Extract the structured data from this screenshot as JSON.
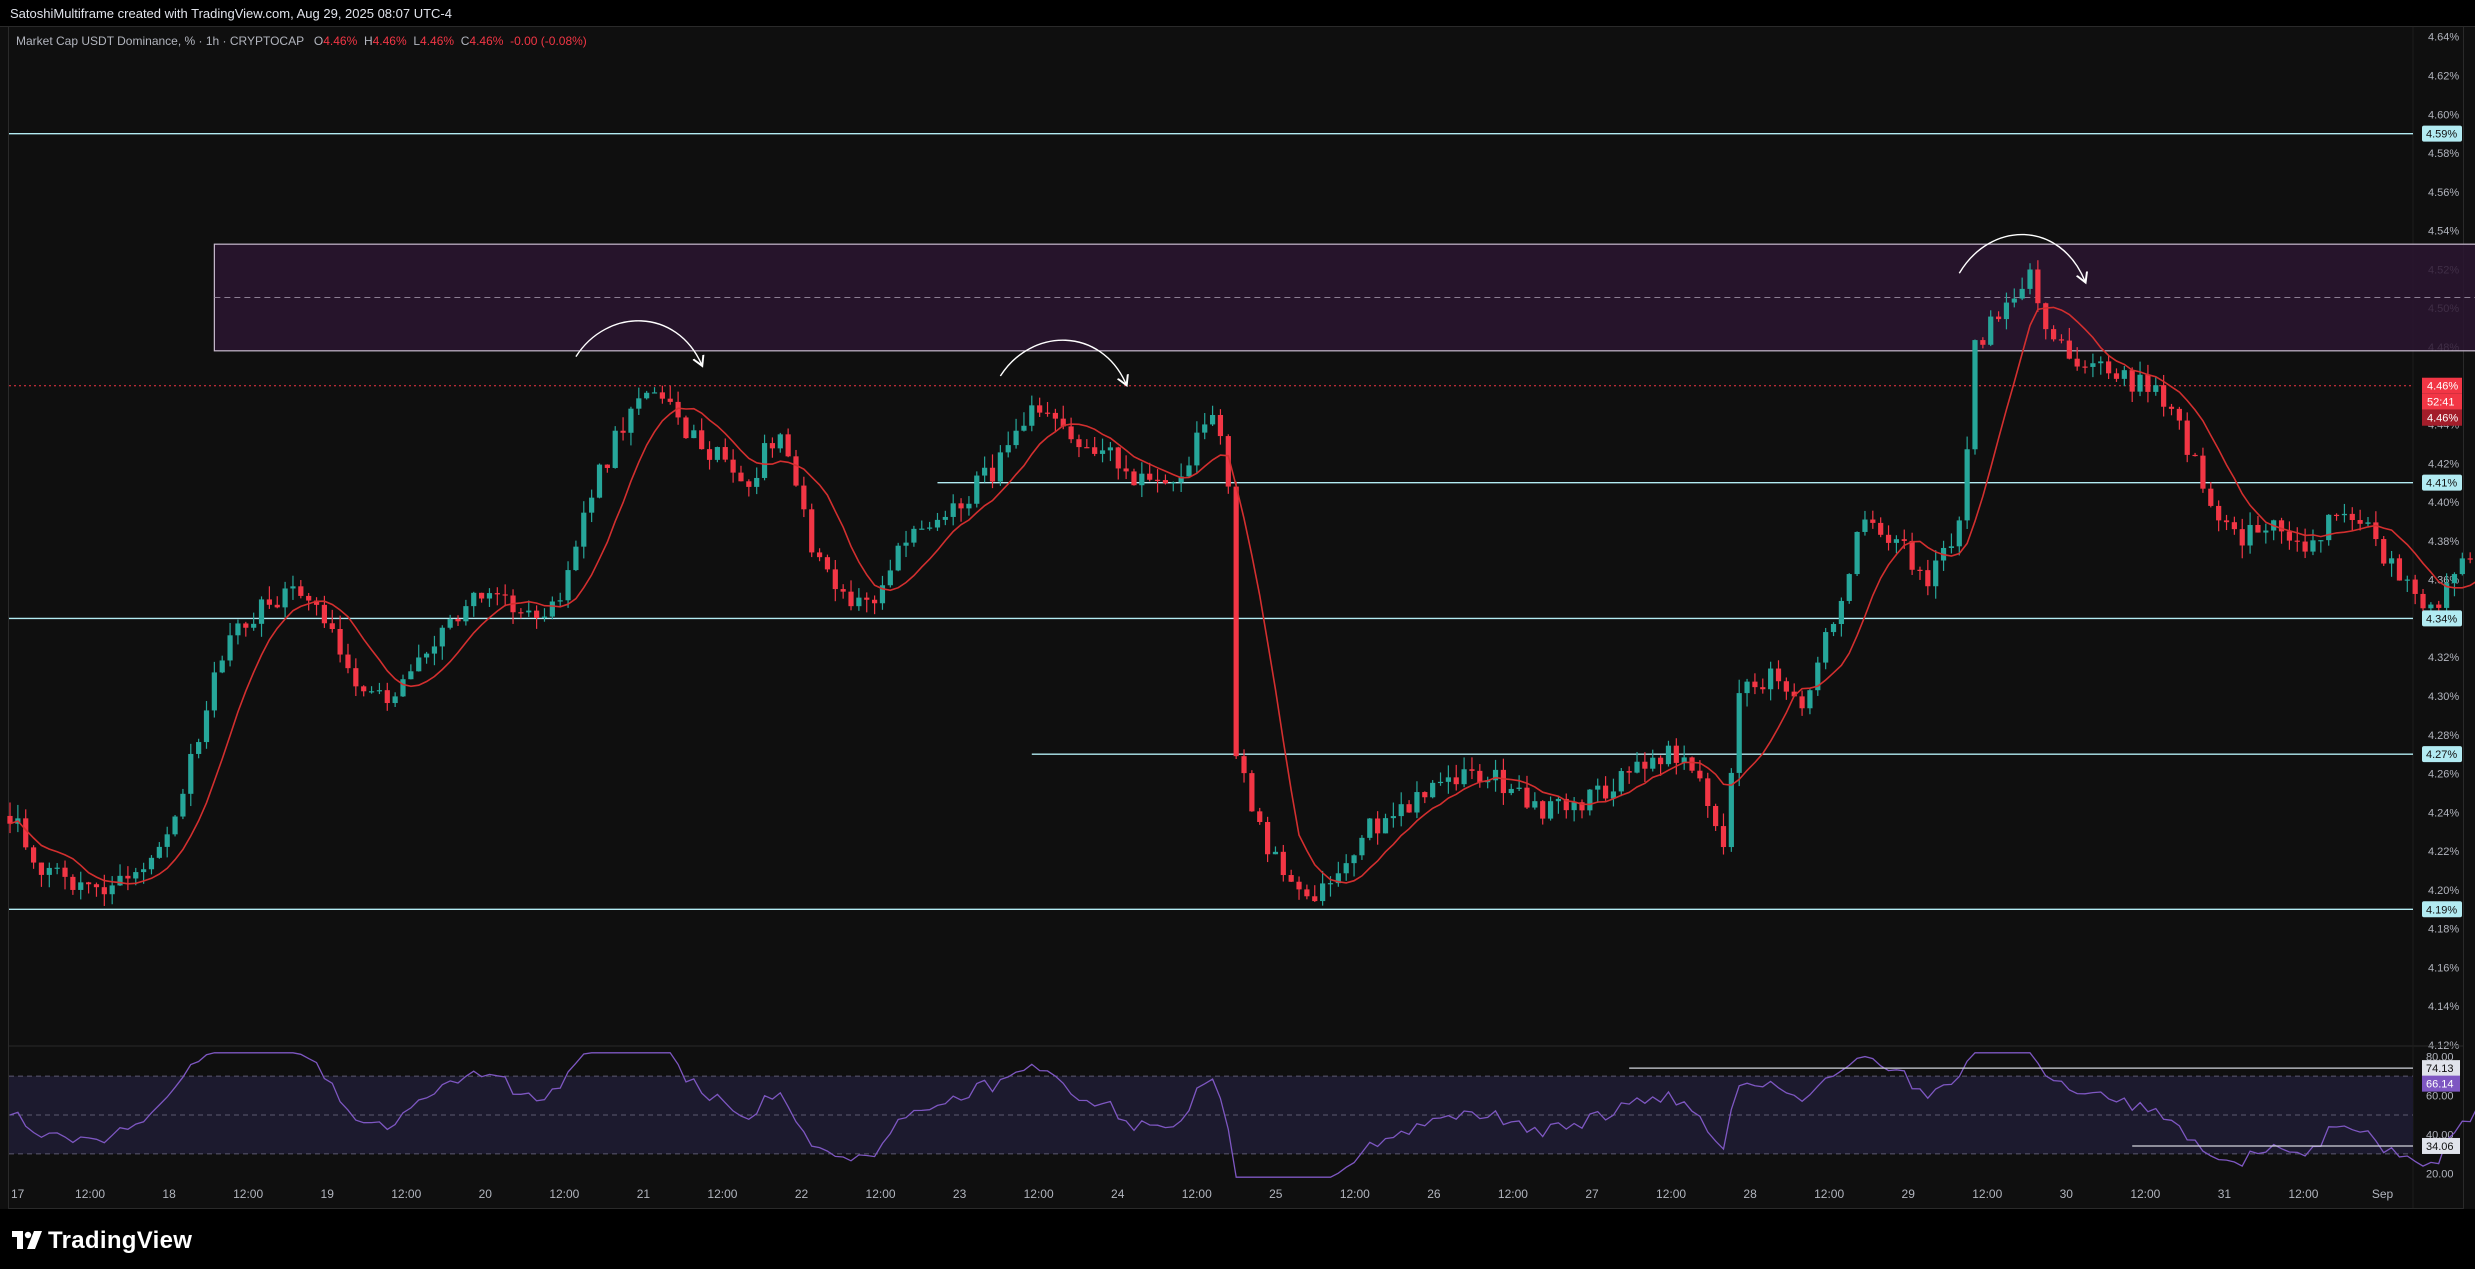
{
  "header": {
    "attribution": "SatoshiMultiframe created with TradingView.com, Aug 29, 2025 08:07 UTC-4"
  },
  "legend": {
    "symbol": "Market Cap USDT Dominance, % · 1h · CRYPTOCAP",
    "o_label": "O",
    "o_value": "4.46%",
    "h_label": "H",
    "h_value": "4.46%",
    "l_label": "L",
    "l_value": "4.46%",
    "c_label": "C",
    "c_value": "4.46%",
    "change": "-0.00 (-0.08%)"
  },
  "footer": {
    "brand": "TradingView"
  },
  "colors": {
    "background": "#0f0f0f",
    "up": "#26a69a",
    "down": "#f23645",
    "ma": "#d32f2f",
    "level": "#b2ebf2",
    "zone_fill": "#2a1530",
    "zone_border": "#c9bccf",
    "rsi": "#7e57c2",
    "rsi_band": "#1c1a2e"
  },
  "chart_data": [
    {
      "type": "candlestick",
      "symbol": "Market Cap USDT Dominance",
      "interval": "1h",
      "ylim": [
        4.12,
        4.645
      ],
      "y_ticks": [
        "4.64%",
        "4.62%",
        "4.60%",
        "4.58%",
        "4.56%",
        "4.54%",
        "4.52%",
        "4.50%",
        "4.48%",
        "4.46%",
        "4.44%",
        "4.42%",
        "4.40%",
        "4.38%",
        "4.36%",
        "4.34%",
        "4.32%",
        "4.30%",
        "4.28%",
        "4.26%",
        "4.24%",
        "4.22%",
        "4.20%",
        "4.18%",
        "4.16%",
        "4.14%",
        "4.12%"
      ],
      "x_ticks": [
        "17",
        "12:00",
        "18",
        "12:00",
        "19",
        "12:00",
        "20",
        "12:00",
        "21",
        "12:00",
        "22",
        "12:00",
        "23",
        "12:00",
        "24",
        "12:00",
        "25",
        "12:00",
        "26",
        "12:00",
        "27",
        "12:00",
        "28",
        "12:00",
        "29",
        "12:00",
        "30",
        "12:00",
        "31",
        "12:00",
        "Sep"
      ],
      "anchors": [
        {
          "t": 0,
          "v": 4.24
        },
        {
          "t": 4,
          "v": 4.21
        },
        {
          "t": 10,
          "v": 4.2
        },
        {
          "t": 18,
          "v": 4.215
        },
        {
          "t": 22,
          "v": 4.25
        },
        {
          "t": 28,
          "v": 4.335
        },
        {
          "t": 34,
          "v": 4.35
        },
        {
          "t": 38,
          "v": 4.355
        },
        {
          "t": 44,
          "v": 4.31
        },
        {
          "t": 48,
          "v": 4.295
        },
        {
          "t": 52,
          "v": 4.315
        },
        {
          "t": 56,
          "v": 4.34
        },
        {
          "t": 62,
          "v": 4.355
        },
        {
          "t": 66,
          "v": 4.34
        },
        {
          "t": 70,
          "v": 4.35
        },
        {
          "t": 74,
          "v": 4.405
        },
        {
          "t": 78,
          "v": 4.44
        },
        {
          "t": 82,
          "v": 4.46
        },
        {
          "t": 86,
          "v": 4.435
        },
        {
          "t": 90,
          "v": 4.425
        },
        {
          "t": 94,
          "v": 4.41
        },
        {
          "t": 98,
          "v": 4.44
        },
        {
          "t": 102,
          "v": 4.38
        },
        {
          "t": 106,
          "v": 4.35
        },
        {
          "t": 110,
          "v": 4.35
        },
        {
          "t": 114,
          "v": 4.38
        },
        {
          "t": 118,
          "v": 4.39
        },
        {
          "t": 122,
          "v": 4.405
        },
        {
          "t": 126,
          "v": 4.42
        },
        {
          "t": 130,
          "v": 4.445
        },
        {
          "t": 134,
          "v": 4.435
        },
        {
          "t": 138,
          "v": 4.43
        },
        {
          "t": 142,
          "v": 4.415
        },
        {
          "t": 146,
          "v": 4.41
        },
        {
          "t": 150,
          "v": 4.42
        },
        {
          "t": 153,
          "v": 4.45
        },
        {
          "t": 155,
          "v": 4.41
        },
        {
          "t": 156,
          "v": 4.27
        },
        {
          "t": 160,
          "v": 4.22
        },
        {
          "t": 164,
          "v": 4.195
        },
        {
          "t": 168,
          "v": 4.2
        },
        {
          "t": 172,
          "v": 4.23
        },
        {
          "t": 176,
          "v": 4.24
        },
        {
          "t": 182,
          "v": 4.255
        },
        {
          "t": 186,
          "v": 4.26
        },
        {
          "t": 190,
          "v": 4.255
        },
        {
          "t": 196,
          "v": 4.24
        },
        {
          "t": 200,
          "v": 4.245
        },
        {
          "t": 206,
          "v": 4.26
        },
        {
          "t": 210,
          "v": 4.27
        },
        {
          "t": 214,
          "v": 4.265
        },
        {
          "t": 218,
          "v": 4.22
        },
        {
          "t": 220,
          "v": 4.3
        },
        {
          "t": 224,
          "v": 4.31
        },
        {
          "t": 228,
          "v": 4.29
        },
        {
          "t": 232,
          "v": 4.34
        },
        {
          "t": 236,
          "v": 4.395
        },
        {
          "t": 240,
          "v": 4.38
        },
        {
          "t": 244,
          "v": 4.36
        },
        {
          "t": 248,
          "v": 4.385
        },
        {
          "t": 250,
          "v": 4.48
        },
        {
          "t": 254,
          "v": 4.5
        },
        {
          "t": 257,
          "v": 4.515
        },
        {
          "t": 260,
          "v": 4.48
        },
        {
          "t": 264,
          "v": 4.47
        },
        {
          "t": 268,
          "v": 4.465
        },
        {
          "t": 272,
          "v": 4.46
        },
        {
          "t": 276,
          "v": 4.44
        },
        {
          "t": 280,
          "v": 4.4
        },
        {
          "t": 284,
          "v": 4.38
        },
        {
          "t": 288,
          "v": 4.39
        },
        {
          "t": 292,
          "v": 4.37
        },
        {
          "t": 296,
          "v": 4.395
        },
        {
          "t": 300,
          "v": 4.385
        },
        {
          "t": 304,
          "v": 4.36
        },
        {
          "t": 308,
          "v": 4.345
        },
        {
          "t": 312,
          "v": 4.37
        },
        {
          "t": 316,
          "v": 4.39
        },
        {
          "t": 320,
          "v": 4.36
        },
        {
          "t": 324,
          "v": 4.33
        },
        {
          "t": 328,
          "v": 4.325
        },
        {
          "t": 332,
          "v": 4.33
        },
        {
          "t": 336,
          "v": 4.365
        },
        {
          "t": 340,
          "v": 4.385
        },
        {
          "t": 344,
          "v": 4.37
        },
        {
          "t": 346,
          "v": 4.355
        },
        {
          "t": 350,
          "v": 4.39
        },
        {
          "t": 352,
          "v": 4.44
        },
        {
          "t": 354,
          "v": 4.48
        },
        {
          "t": 356,
          "v": 4.47
        },
        {
          "t": 358,
          "v": 4.46
        },
        {
          "t": 359,
          "v": 4.46
        }
      ],
      "levels": [
        {
          "value": 4.59,
          "label": "4.59%",
          "from_t": -20
        },
        {
          "value": 4.41,
          "label": "4.41%",
          "from_t": 118
        },
        {
          "value": 4.34,
          "label": "4.34%",
          "from_t": -20
        },
        {
          "value": 4.27,
          "label": "4.27%",
          "from_t": 130
        },
        {
          "value": 4.19,
          "label": "4.19%",
          "from_t": -20
        }
      ],
      "zone": {
        "from_t": 26,
        "to_t": 453,
        "top": 4.533,
        "bottom": 4.478
      },
      "current_price": {
        "value": 4.46,
        "labels": [
          "4.46%",
          "52:41",
          "4.46%"
        ]
      },
      "annotations": [
        {
          "type": "arrow-arc",
          "from_t": 72,
          "to_t": 88,
          "base": 4.475,
          "peak": 4.491
        },
        {
          "type": "arrow-arc",
          "from_t": 126,
          "to_t": 142,
          "base": 4.465,
          "peak": 4.481
        },
        {
          "type": "arrow-arc",
          "from_t": 248,
          "to_t": 264,
          "base": 4.518,
          "peak": 4.536
        },
        {
          "type": "arrow-arc",
          "from_t": 352,
          "to_t": 368,
          "base": 4.48,
          "peak": 4.497
        }
      ]
    },
    {
      "type": "line",
      "name": "RSI",
      "ylim": [
        15,
        85
      ],
      "band": [
        30,
        70
      ],
      "y_ticks": [
        "80.00",
        "60.00",
        "40.00",
        "20.00"
      ],
      "last_value": "66.14",
      "value_labels": [
        {
          "value": 74.13,
          "label": "74.13",
          "from_t": 206
        },
        {
          "value": 34.06,
          "label": "34.06",
          "from_t": 270
        }
      ],
      "x_ticks": [
        "17",
        "12:00",
        "18",
        "12:00",
        "19",
        "12:00",
        "20",
        "12:00",
        "21",
        "12:00",
        "22",
        "12:00",
        "23",
        "12:00",
        "24",
        "12:00",
        "25",
        "12:00",
        "26",
        "12:00",
        "27",
        "12:00",
        "28",
        "12:00",
        "29",
        "12:00",
        "30",
        "12:00",
        "31",
        "12:00",
        "Sep"
      ]
    }
  ]
}
